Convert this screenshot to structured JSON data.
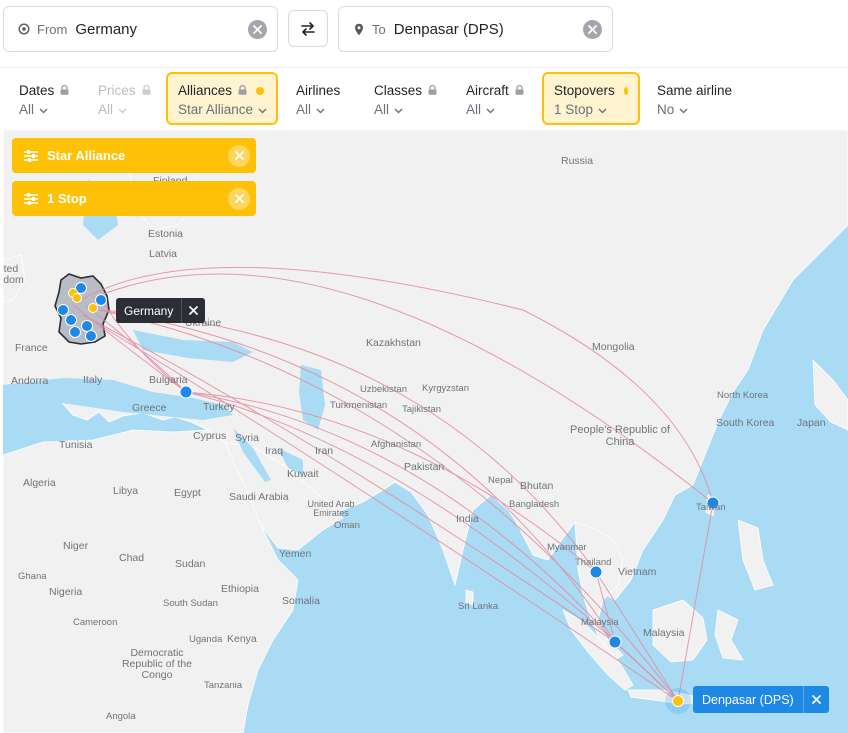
{
  "search": {
    "from_label": "From",
    "from_value": "Germany",
    "to_label": "To",
    "to_value": "Denpasar (DPS)"
  },
  "filters": [
    {
      "title": "Dates",
      "value": "All",
      "locked": true,
      "active": false,
      "disabled": false
    },
    {
      "title": "Prices",
      "value": "All",
      "locked": true,
      "active": false,
      "disabled": true
    },
    {
      "title": "Alliances",
      "value": "Star Alliance",
      "locked": true,
      "active": true,
      "disabled": false
    },
    {
      "title": "Airlines",
      "value": "All",
      "locked": false,
      "active": false,
      "disabled": false
    },
    {
      "title": "Classes",
      "value": "All",
      "locked": true,
      "active": false,
      "disabled": false
    },
    {
      "title": "Aircraft",
      "value": "All",
      "locked": true,
      "active": false,
      "disabled": false
    },
    {
      "title": "Stopovers",
      "value": "1 Stop",
      "locked": false,
      "active": true,
      "disabled": false
    },
    {
      "title": "Same airline",
      "value": "No",
      "locked": false,
      "active": false,
      "disabled": false
    }
  ],
  "map": {
    "chips": [
      {
        "label": "Star Alliance"
      },
      {
        "label": "1 Stop"
      }
    ],
    "origin_tag": "Germany",
    "destination_tag": "Denpasar (DPS)",
    "place_labels": {
      "russia": "Russia",
      "finland": "Finland",
      "estonia": "Estonia",
      "latvia": "Latvia",
      "uk": "United Kingdom",
      "france": "France",
      "andorra": "Andorra",
      "italy": "Italy",
      "ukraine": "Ukraine",
      "bulgaria": "Bulgaria",
      "greece": "Greece",
      "turkey": "Turkey",
      "cyprus": "Cyprus",
      "syria": "Syria",
      "tunisia": "Tunisia",
      "algeria": "Algeria",
      "libya": "Libya",
      "egypt": "Egypt",
      "iraq": "Iraq",
      "iran": "Iran",
      "kuwait": "Kuwait",
      "saudi": "Saudi Arabia",
      "uae": "United Arab Emirates",
      "oman": "Oman",
      "yemen": "Yemen",
      "kazakhstan": "Kazakhstan",
      "uzbekistan": "Uzbekistan",
      "kyrgyzstan": "Kyrgyzstan",
      "turkmenistan": "Turkmenistan",
      "tajikistan": "Tajikistan",
      "afghanistan": "Afghanistan",
      "pakistan": "Pakistan",
      "india": "India",
      "nepal": "Nepal",
      "bhutan": "Bhutan",
      "bangladesh": "Bangladesh",
      "myanmar": "Myanmar",
      "thailand": "Thailand",
      "vietnam": "Vietnam",
      "mongolia": "Mongolia",
      "china": "People's Republic of China",
      "north_korea": "North Korea",
      "south_korea": "South Korea",
      "japan": "Japan",
      "taiwan": "Taiwan",
      "sri_lanka": "Sri Lanka",
      "malaysia_w": "Malaysia",
      "malaysia_e": "Malaysia",
      "niger": "Niger",
      "chad": "Chad",
      "sudan": "Sudan",
      "nigeria": "Nigeria",
      "ethiopia": "Ethiopia",
      "somalia": "Somalia",
      "cameroon": "Cameroon",
      "south_sudan": "South Sudan",
      "uganda": "Uganda",
      "kenya": "Kenya",
      "drc": "Democratic Republic of the Congo",
      "tanzania": "Tanzania",
      "angola": "Angola",
      "ghana": "Ghana"
    }
  },
  "colors": {
    "accent": "#ffc107",
    "accent_bg": "#fff4cf",
    "route": "#e58aa0",
    "airport": "#1e88e5",
    "destination": "#1e88e5"
  }
}
